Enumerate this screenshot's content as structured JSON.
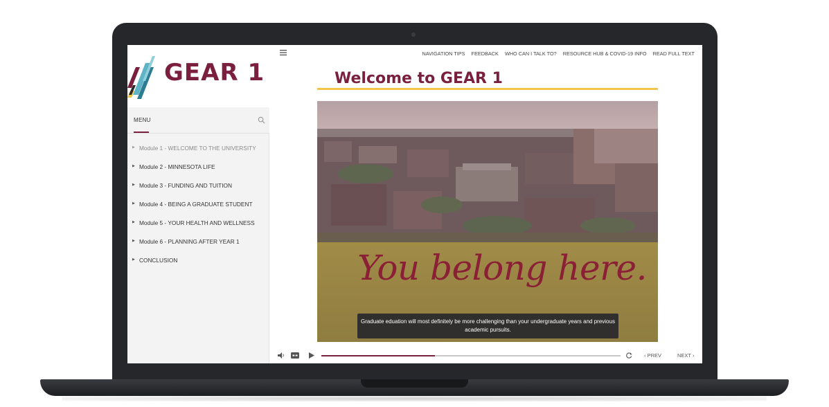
{
  "brand": {
    "logo_text": "GEAR 1",
    "primary_color": "#7a1f3d",
    "accent_color": "#f1c54d"
  },
  "sidebar": {
    "menu_label": "MENU",
    "items": [
      {
        "label": "Module 1 - WELCOME TO THE UNIVERSITY",
        "active": true
      },
      {
        "label": "Module 2 - MINNESOTA LIFE"
      },
      {
        "label": "Module 3 - FUNDING AND TUITION"
      },
      {
        "label": "Module 4 - BEING A GRADUATE STUDENT"
      },
      {
        "label": "Module 5 - YOUR HEALTH AND WELLNESS"
      },
      {
        "label": "Module 6 - PLANNING AFTER YEAR 1"
      },
      {
        "label": "CONCLUSION"
      }
    ]
  },
  "topnav": [
    "NAVIGATION TIPS",
    "FEEDBACK",
    "WHO CAN I TALK TO?",
    "RESOURCE HUB & COVID-19 INFO",
    "READ FULL TEXT"
  ],
  "main": {
    "title_prefix": "Welcome to ",
    "title_bold": "GEAR 1",
    "video_overlay": "You belong here.",
    "caption": "Graduate eduation will most definitely be more challenging than your undergraduate years and previous academic pursuits."
  },
  "player": {
    "progress": 0.38,
    "prev_label": "PREV",
    "next_label": "NEXT"
  },
  "icons": [
    "hamburger-icon",
    "search-icon",
    "volume-icon",
    "closed-caption-icon",
    "play-icon",
    "replay-icon",
    "chevron-left-icon",
    "chevron-right-icon"
  ]
}
